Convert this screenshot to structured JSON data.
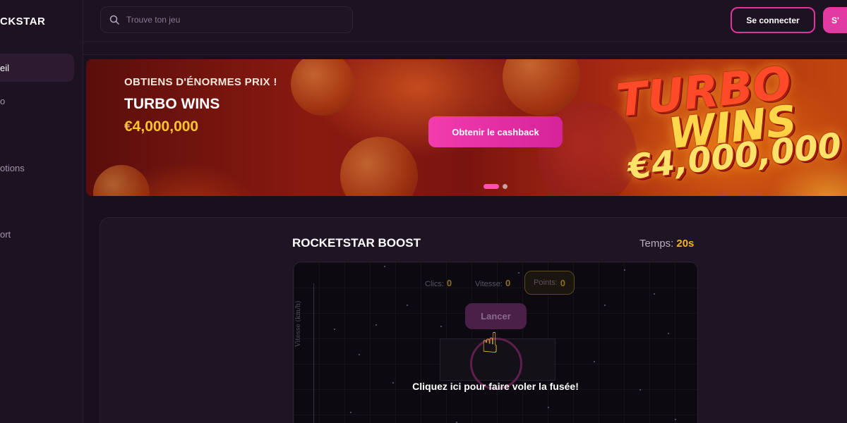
{
  "sidebar": {
    "brand": "CKSTAR",
    "items": [
      {
        "label": "eil",
        "active": true
      },
      {
        "label": "o"
      },
      {
        "label": "otions"
      },
      {
        "label": "ort"
      }
    ]
  },
  "header": {
    "search_placeholder": "Trouve ton jeu",
    "login_label": "Se connecter",
    "signup_label": "S'"
  },
  "banner": {
    "kicker": "OBTIENS D'ÉNORMES PRIX !",
    "title": "TURBO WINS",
    "amount": "€4,000,000",
    "cta_label": "Obtenir le cashback",
    "logo_line1": "TURBO",
    "logo_line2": "WINS",
    "logo_line3": "€4,000,000",
    "slides": 2,
    "active_slide": 1
  },
  "game": {
    "title": "ROCKETSTAR BOOST",
    "timer_label": "Temps:",
    "timer_value": "20s",
    "stats": {
      "clicks_label": "Clics:",
      "clicks_value": "0",
      "speed_label": "Vitesse:",
      "speed_value": "0",
      "points_label": "Points:",
      "points_value": "0"
    },
    "axis_label": "Vitesse (km/h)",
    "launch_label": "Lancer",
    "hint": "Cliquez ici pour faire voler la fusée!"
  },
  "colors": {
    "accent": "#e23aa3",
    "background": "#1a0f1f",
    "timer_value": "#f0b429"
  },
  "icons": {
    "search": "search-icon",
    "pointer": "pointing-hand-icon"
  }
}
